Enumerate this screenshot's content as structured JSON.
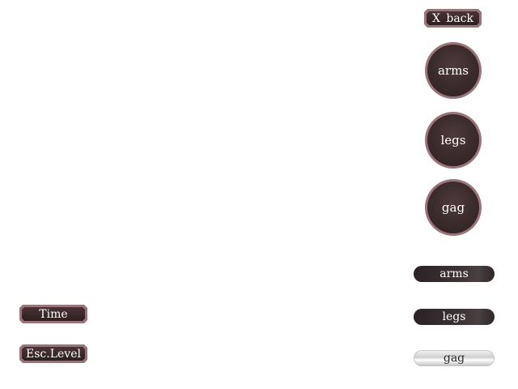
{
  "back_button": {
    "key": "X",
    "label": "back"
  },
  "round_buttons": [
    {
      "label": "arms"
    },
    {
      "label": "legs"
    },
    {
      "label": "gag"
    }
  ],
  "status_bars": [
    {
      "label": "arms",
      "style": "dark"
    },
    {
      "label": "legs",
      "style": "dark"
    },
    {
      "label": "gag",
      "style": "light"
    }
  ],
  "info_plates": {
    "time_label": "Time",
    "esc_level_label": "Esc.Level"
  },
  "colors": {
    "background": "#ffffff",
    "frame": "#9a7478",
    "button_fill": "#3a2a2c",
    "text_light": "#ffffff"
  }
}
